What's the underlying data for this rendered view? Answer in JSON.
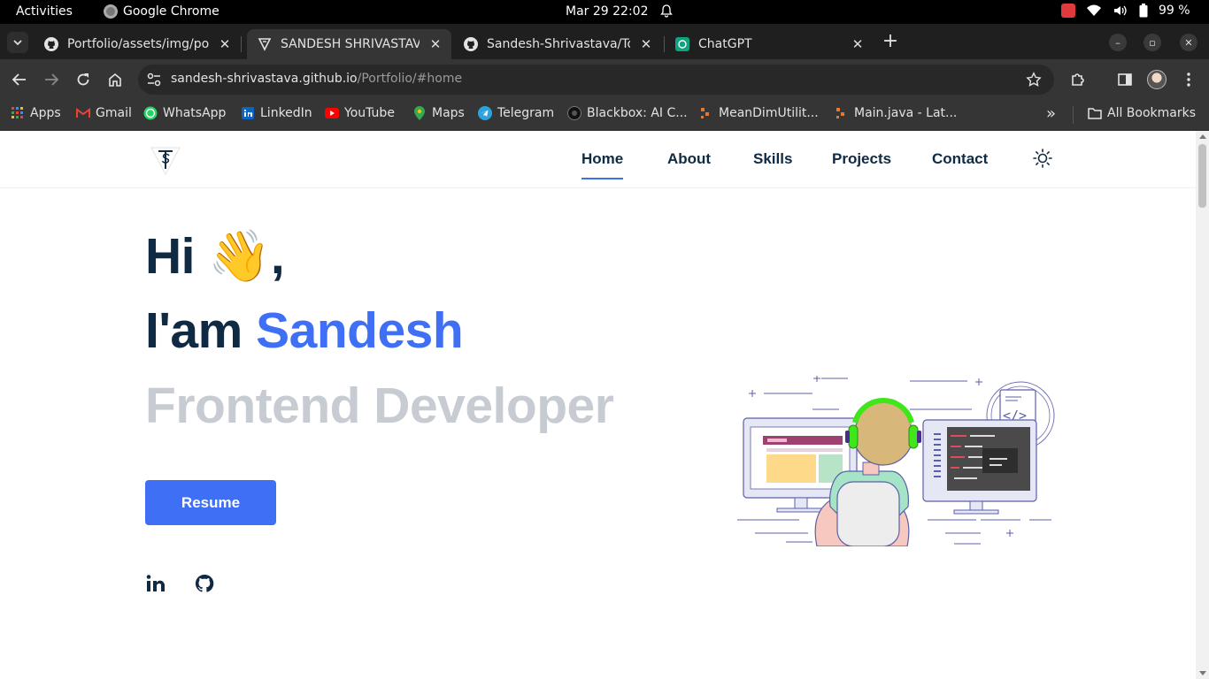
{
  "system_bar": {
    "activities": "Activities",
    "app_name": "Google Chrome",
    "clock": "Mar 29  22:02",
    "battery": "99 %"
  },
  "tabs": [
    {
      "title": "Portfolio/assets/img/po",
      "icon": "github-icon",
      "active": false
    },
    {
      "title": "SANDESH SHRIVASTAVA",
      "icon": "site-logo-icon",
      "active": true
    },
    {
      "title": "Sandesh-Shrivastava/To",
      "icon": "github-icon",
      "active": false
    },
    {
      "title": "ChatGPT",
      "icon": "chatgpt-icon",
      "active": false
    }
  ],
  "omnibox": {
    "domain": "sandesh-shrivastava.github.io",
    "path": "/Portfolio/#home"
  },
  "bookmarks": {
    "items": [
      {
        "label": "Apps"
      },
      {
        "label": "Gmail"
      },
      {
        "label": "WhatsApp"
      },
      {
        "label": "LinkedIn"
      },
      {
        "label": "YouTube"
      },
      {
        "label": "Maps"
      },
      {
        "label": "Telegram"
      },
      {
        "label": "Blackbox: AI C..."
      },
      {
        "label": "MeanDimUtilit..."
      },
      {
        "label": "Main.java - Lat..."
      }
    ],
    "overflow": "»",
    "all_bookmarks": "All Bookmarks"
  },
  "site": {
    "nav": [
      {
        "label": "Home",
        "active": true
      },
      {
        "label": "About",
        "active": false
      },
      {
        "label": "Skills",
        "active": false
      },
      {
        "label": "Projects",
        "active": false
      },
      {
        "label": "Contact",
        "active": false
      }
    ],
    "hero": {
      "greeting": "Hi",
      "wave": "👋",
      "comma": ",",
      "intro": "I'am ",
      "name": "Sandesh",
      "role": "Frontend Developer",
      "resume_button": "Resume"
    }
  },
  "colors": {
    "accent": "#3e6ff4",
    "heading": "#102a43",
    "muted_role": "#c7ccd2",
    "browser_dark": "#353535"
  }
}
